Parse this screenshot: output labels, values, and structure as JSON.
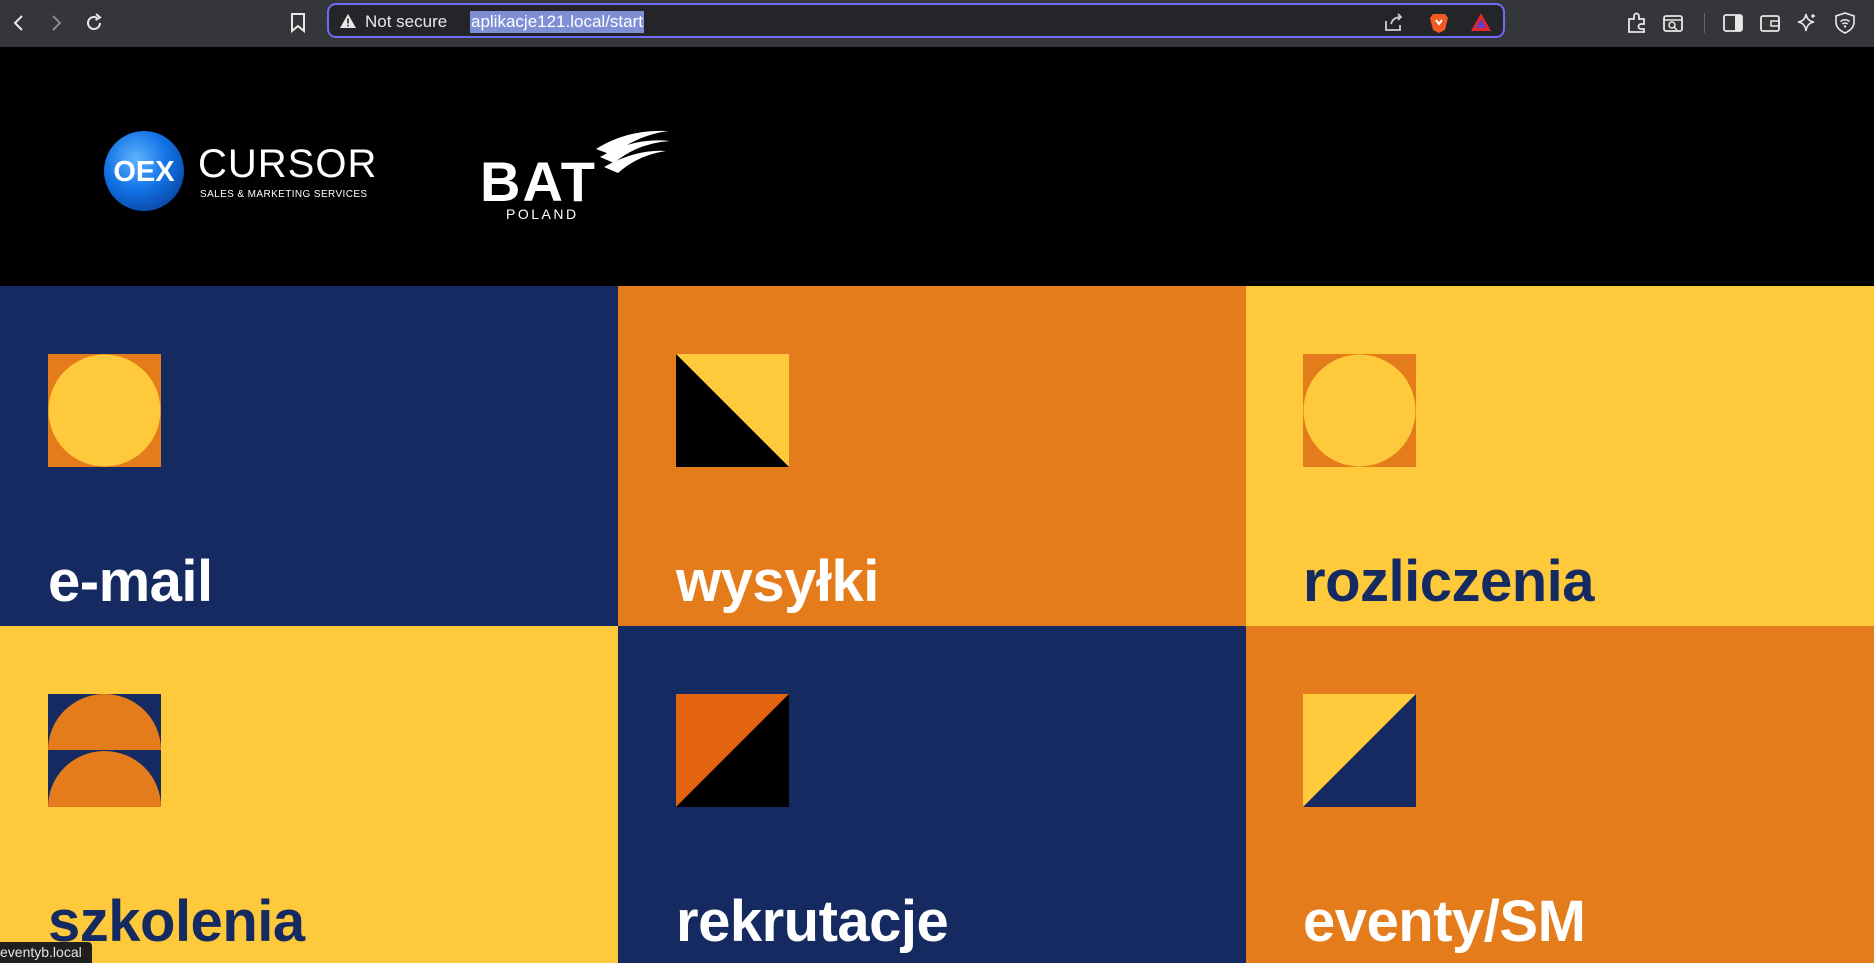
{
  "browser": {
    "security_label": "Not secure",
    "url": "aplikacje121.local/start",
    "accent": "#6f6cf5"
  },
  "colors": {
    "navy": "#162a62",
    "orange": "#e47c1b",
    "yellow": "#ffc93c",
    "dark_orange": "#e2620e",
    "black": "#000000",
    "white": "#ffffff"
  },
  "header": {
    "oex_badge": "OEX",
    "oex_name": "CURSOR",
    "oex_tagline": "SALES & MARKETING SERVICES",
    "bat_name": "BAT",
    "bat_sub": "POLAND"
  },
  "tiles": [
    {
      "label": "e-mail",
      "icon": "circle-in-square-icon"
    },
    {
      "label": "wysyłki",
      "icon": "diagonal-split-square-icon"
    },
    {
      "label": "rozliczenia",
      "icon": "circle-in-square-icon"
    },
    {
      "label": "szkolenia",
      "icon": "half-circles-icon"
    },
    {
      "label": "rekrutacje",
      "icon": "diagonal-split-square-icon"
    },
    {
      "label": "eventy/SM",
      "icon": "diagonal-split-square-icon"
    }
  ],
  "status_bar": {
    "text": "eventyb.local"
  }
}
